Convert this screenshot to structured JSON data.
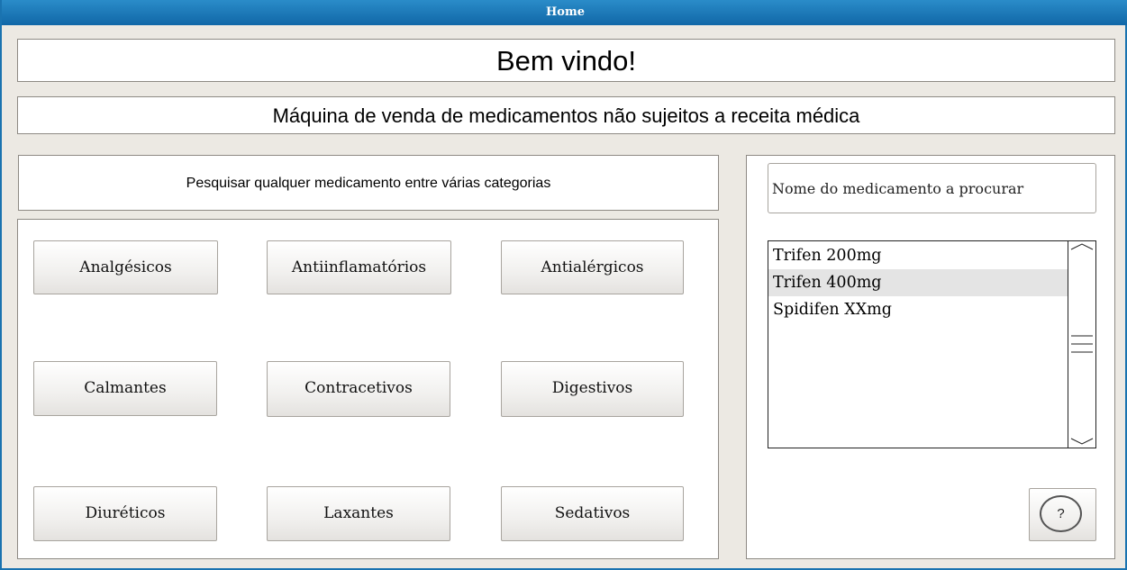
{
  "window": {
    "title": "Home"
  },
  "header": {
    "welcome": "Bem vindo!",
    "subtitle": "Máquina de venda de medicamentos não sujeitos a receita médica"
  },
  "categories_panel": {
    "hint": "Pesquisar qualquer medicamento entre várias categorias",
    "buttons": [
      "Analgésicos",
      "Antiinflamatórios",
      "Antialérgicos",
      "Calmantes",
      "Contracetivos",
      "Digestivos",
      "Diuréticos",
      "Laxantes",
      "Sedativos"
    ]
  },
  "search": {
    "placeholder": "Nome do medicamento a procurar",
    "results": [
      {
        "label": "Trifen 200mg",
        "selected": false
      },
      {
        "label": "Trifen 400mg",
        "selected": true
      },
      {
        "label": "Spidifen XXmg",
        "selected": false
      }
    ]
  },
  "help": {
    "label": "?"
  },
  "colors": {
    "titlebar": "#1a73b0",
    "selection": "#e4e4e4",
    "background": "#ece9e3"
  }
}
